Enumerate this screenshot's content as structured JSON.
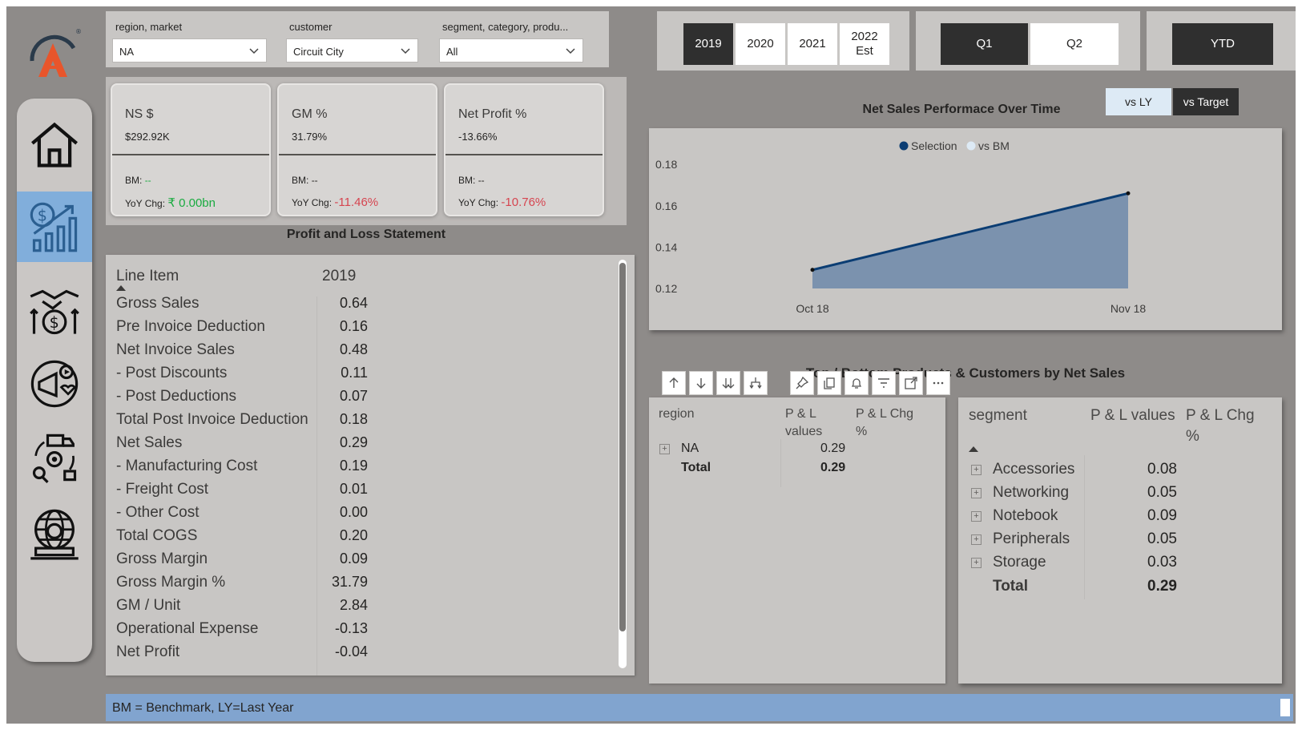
{
  "slicers": [
    {
      "title": "region, market",
      "value": "NA"
    },
    {
      "title": "customer",
      "value": "Circuit City"
    },
    {
      "title": "segment, category, produ...",
      "value": "All"
    }
  ],
  "years": [
    {
      "label": "2019",
      "selected": true
    },
    {
      "label": "2020",
      "selected": false
    },
    {
      "label": "2021",
      "selected": false
    },
    {
      "label": "2022 Est",
      "selected": false
    }
  ],
  "quarters": [
    {
      "label": "Q1",
      "selected": true
    },
    {
      "label": "Q2",
      "selected": false
    }
  ],
  "ytd": {
    "label": "YTD"
  },
  "kpis": [
    {
      "title": "NS $",
      "value": "$292.92K",
      "bm_label": "BM:",
      "bm_value": "--",
      "yoy_label": "YoY Chg:",
      "yoy_value": "₹ 0.00bn",
      "yoy_color": "#1aab40"
    },
    {
      "title": "GM %",
      "value": "31.79%",
      "bm_label": "BM:",
      "bm_value": "--",
      "yoy_label": "YoY Chg:",
      "yoy_value": "-11.46%",
      "yoy_color": "#d64550"
    },
    {
      "title": "Net Profit %",
      "value": "-13.66%",
      "bm_label": "BM:",
      "bm_value": "--",
      "yoy_label": "YoY Chg:",
      "yoy_value": "-10.76%",
      "yoy_color": "#d64550"
    }
  ],
  "pl": {
    "title": "Profit and Loss Statement",
    "col_item": "Line Item",
    "col_year": "2019",
    "rows": [
      {
        "label": "Gross Sales",
        "value": "0.64"
      },
      {
        "label": "Pre Invoice Deduction",
        "value": "0.16"
      },
      {
        "label": "Net Invoice Sales",
        "value": "0.48"
      },
      {
        "label": "- Post Discounts",
        "value": "0.11"
      },
      {
        "label": "- Post Deductions",
        "value": "0.07"
      },
      {
        "label": "Total Post Invoice Deduction",
        "value": "0.18"
      },
      {
        "label": "Net Sales",
        "value": "0.29"
      },
      {
        "label": "- Manufacturing Cost",
        "value": "0.19"
      },
      {
        "label": "- Freight Cost",
        "value": "0.01"
      },
      {
        "label": "- Other Cost",
        "value": "0.00"
      },
      {
        "label": "Total COGS",
        "value": "0.20"
      },
      {
        "label": "Gross Margin",
        "value": "0.09"
      },
      {
        "label": "Gross Margin %",
        "value": "31.79"
      },
      {
        "label": "GM / Unit",
        "value": "2.84"
      },
      {
        "label": "Operational Expense",
        "value": "-0.13"
      },
      {
        "label": "Net Profit",
        "value": "-0.04"
      }
    ]
  },
  "toggle": {
    "vs_ly": "vs LY",
    "vs_target": "vs Target"
  },
  "chart_data": {
    "type": "area",
    "title": "Net Sales Performace Over Time",
    "legend": [
      "Selection",
      "vs BM"
    ],
    "legend_position": "top-center",
    "x": [
      "Oct 18",
      "Nov 18"
    ],
    "series": [
      {
        "name": "Selection",
        "values": [
          0.129,
          0.166
        ],
        "color": "#0b3d73"
      },
      {
        "name": "vs BM",
        "values": [],
        "color": "#ddeaf5"
      }
    ],
    "y_ticks": [
      "0.12",
      "0.14",
      "0.16",
      "0.18"
    ],
    "ylim": [
      0.12,
      0.18
    ],
    "grid": false
  },
  "top_bottom": {
    "title": "Top / Bottom Products & Customers by Net Sales",
    "region_table": {
      "col1": "region",
      "col2": "P & L values",
      "col3": "P & L Chg %",
      "rows": [
        {
          "label": "NA",
          "value": "0.29"
        }
      ],
      "total_label": "Total",
      "total_value": "0.29"
    },
    "segment_table": {
      "col1": "segment",
      "col2": "P & L values",
      "col3": "P & L Chg %",
      "rows": [
        {
          "label": "Accessories",
          "value": "0.08"
        },
        {
          "label": "Networking",
          "value": "0.05"
        },
        {
          "label": "Notebook",
          "value": "0.09"
        },
        {
          "label": "Peripherals",
          "value": "0.05"
        },
        {
          "label": "Storage",
          "value": "0.03"
        }
      ],
      "total_label": "Total",
      "total_value": "0.29"
    }
  },
  "footer": {
    "text": "BM = Benchmark, LY=Last Year"
  },
  "colors": {
    "accent_blue": "#81aedb",
    "dark_button": "#2f2f2f",
    "positive": "#1aab40",
    "negative": "#d64550",
    "line": "#0b3d73",
    "area": "#7b92ae"
  }
}
